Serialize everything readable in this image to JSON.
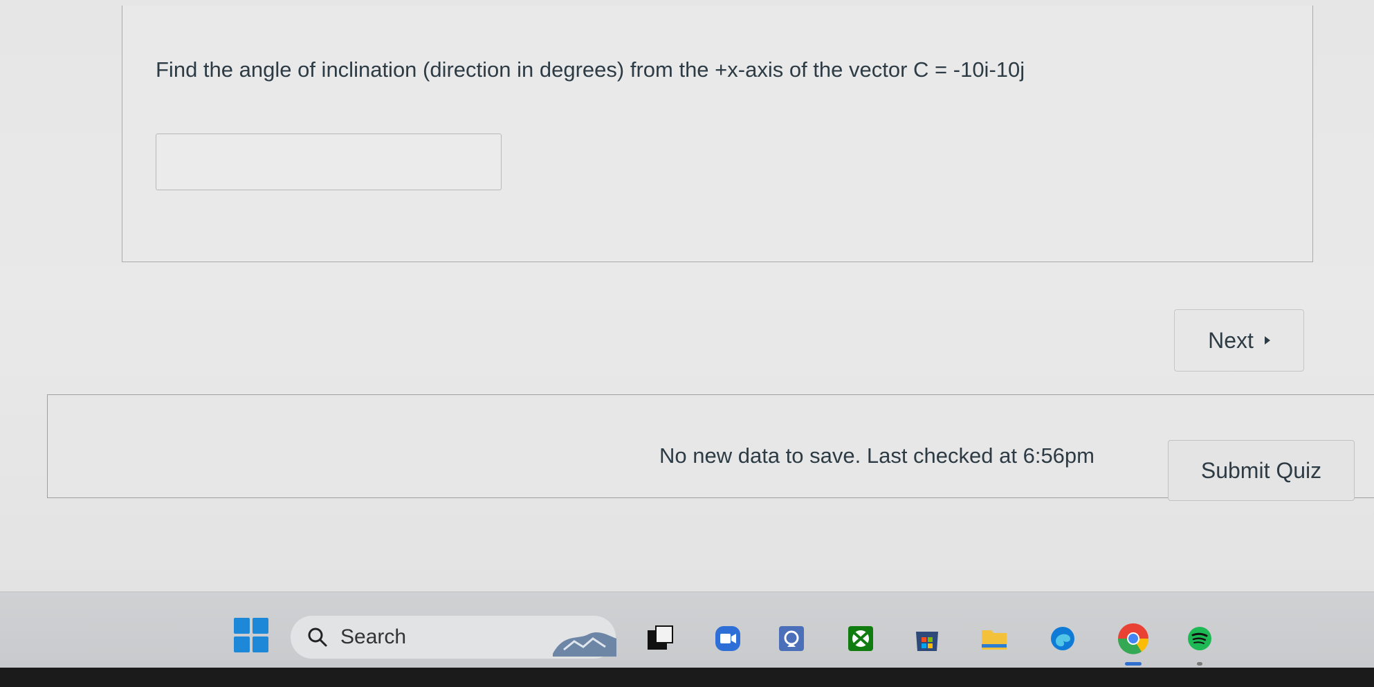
{
  "question": {
    "text": "Find the angle of inclination (direction in degrees) from the +x-axis of the vector C = -10i-10j",
    "answer_value": "",
    "answer_placeholder": ""
  },
  "navigation": {
    "next_label": "Next"
  },
  "submit_bar": {
    "save_status": "No new data to save. Last checked at 6:56pm",
    "submit_label": "Submit Quiz"
  },
  "taskbar": {
    "search_label": "Search",
    "icons": [
      "windows-start-icon",
      "weather-widget-icon",
      "task-view-icon",
      "zoom-icon",
      "meeting-icon",
      "xbox-icon",
      "store-icon",
      "file-explorer-icon",
      "edge-icon",
      "chrome-icon",
      "spotify-icon"
    ],
    "colors": {
      "start": "#1e88d8",
      "zoom": "#2d8cff",
      "xbox": "#107c10",
      "spotify": "#1db954"
    }
  }
}
